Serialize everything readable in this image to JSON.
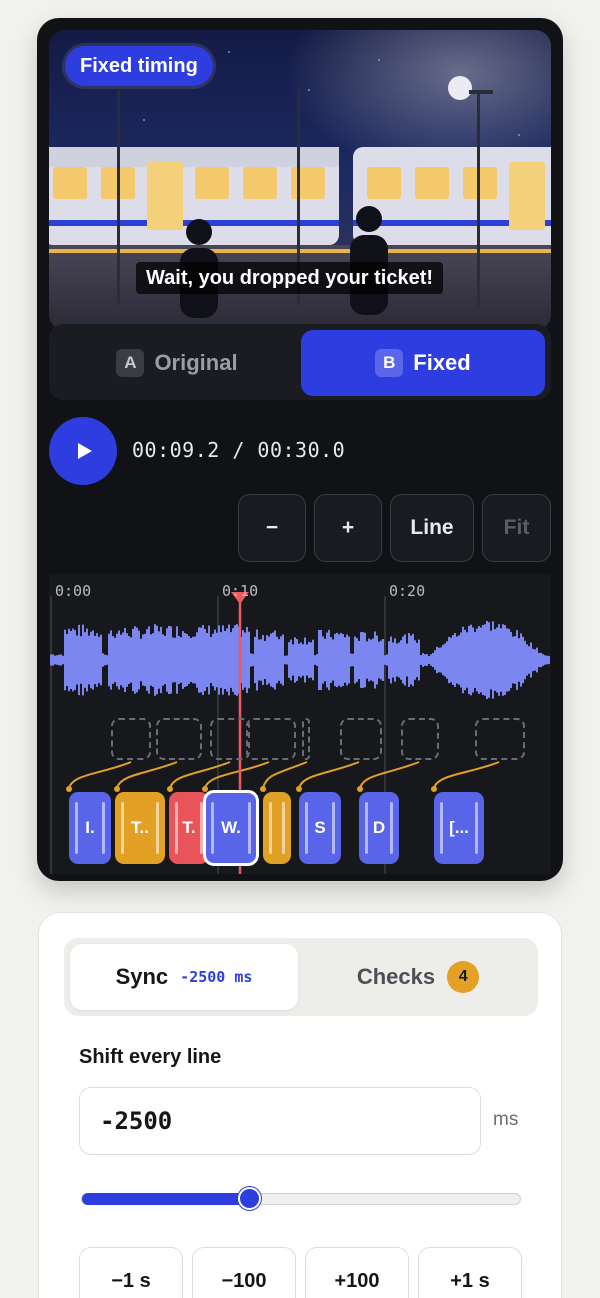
{
  "preview": {
    "mode_badge": "Fixed timing",
    "subtitle": "Wait, you dropped your ticket!"
  },
  "ab_switch": {
    "options": [
      {
        "key": "A",
        "label": "Original",
        "selected": false
      },
      {
        "key": "B",
        "label": "Fixed",
        "selected": true
      }
    ]
  },
  "player": {
    "timecode": "00:09.2 / 00:30.0"
  },
  "zoom_controls": {
    "zoom_out": "−",
    "zoom_in": "+",
    "line": "Line",
    "fit": "Fit"
  },
  "timeline": {
    "tick_labels": [
      "0:00",
      "0:10",
      "0:20"
    ],
    "cues": [
      {
        "label": "I.",
        "color": "blue"
      },
      {
        "label": "T..",
        "color": "orange"
      },
      {
        "label": "T.",
        "color": "red"
      },
      {
        "label": "W.",
        "color": "blue",
        "selected": true
      },
      {
        "label": "",
        "color": "orange"
      },
      {
        "label": "S",
        "color": "blue"
      },
      {
        "label": "D",
        "color": "blue"
      },
      {
        "label": "[...",
        "color": "blue"
      }
    ],
    "colors": {
      "waveform": "#7b86f0",
      "playhead": "#ee5a5f",
      "connector": "#e2a024"
    }
  },
  "panel": {
    "tabs": {
      "sync": {
        "label": "Sync",
        "offset": "-2500 ms"
      },
      "checks": {
        "label": "Checks",
        "count": "4"
      }
    },
    "shift": {
      "label": "Shift every line",
      "value": "-2500",
      "unit": "ms",
      "slider_fraction": 0.38
    },
    "nudge_buttons": [
      "−1 s",
      "−100",
      "+100",
      "+1 s"
    ]
  }
}
